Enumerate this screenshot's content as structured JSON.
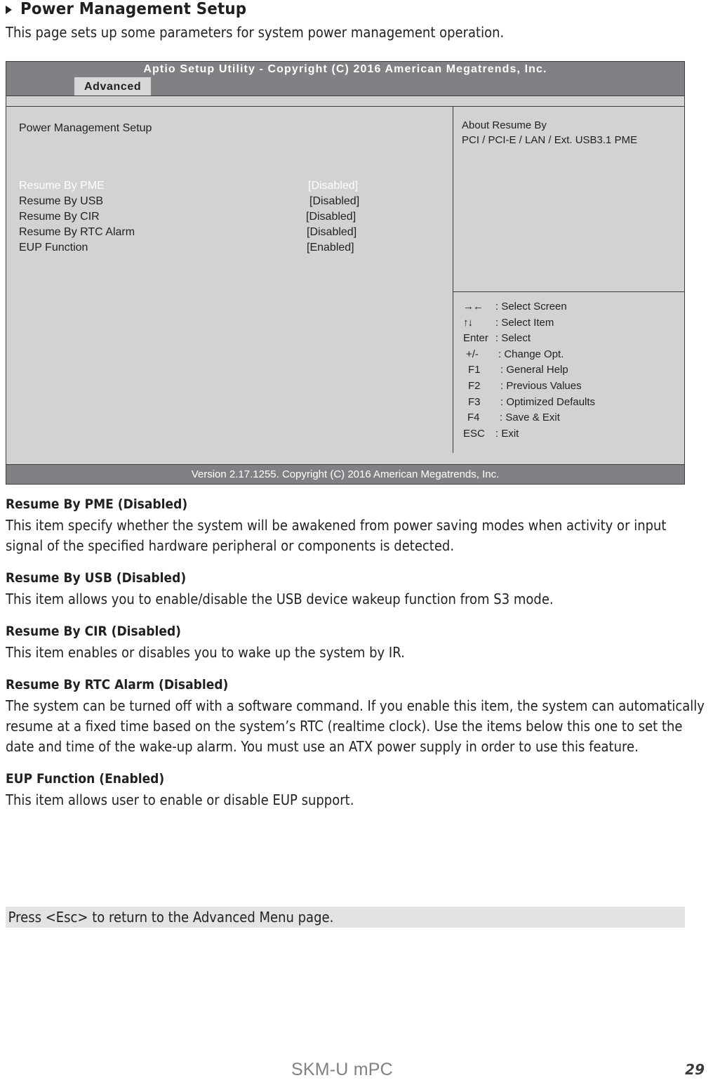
{
  "page": {
    "heading": "Power Management Setup",
    "intro": "This page sets up some parameters for system power management operation.",
    "bullet_icon": "triangle-right-icon",
    "brand": "SKM-U mPC",
    "number": "29",
    "esc_note": "Press <Esc> to return to the Advanced Menu page."
  },
  "bios": {
    "title": "Aptio Setup Utility - Copyright (C) 2016 American Megatrends, Inc.",
    "tab": "Advanced",
    "section_title": "Power Management Setup",
    "footer": "Version 2.17.1255. Copyright (C) 2016 American Megatrends, Inc.",
    "options": [
      {
        "label": "Resume By PME",
        "value": "[Disabled]",
        "selected": true
      },
      {
        "label": "Resume By USB",
        "value": "[Disabled]",
        "selected": false
      },
      {
        "label": "Resume By CIR",
        "value": "[Disabled]",
        "selected": false
      },
      {
        "label": "Resume By RTC Alarm",
        "value": "[Disabled]",
        "selected": false
      },
      {
        "label": "EUP Function",
        "value": "[Enabled]",
        "selected": false
      }
    ],
    "help": {
      "line1": "About Resume By",
      "line2": "PCI / PCI-E / LAN / Ext. USB3.1 PME"
    },
    "legend": [
      {
        "key": "→←",
        "desc": ": Select Screen"
      },
      {
        "key": "↑↓",
        "desc": ": Select Item"
      },
      {
        "key": "Enter",
        "desc": ": Select"
      },
      {
        "key": "+/-",
        "desc": ": Change Opt."
      },
      {
        "key": "F1",
        "desc": ": General Help"
      },
      {
        "key": "F2",
        "desc": ": Previous Values"
      },
      {
        "key": "F3",
        "desc": ": Optimized Defaults"
      },
      {
        "key": "F4",
        "desc": ": Save & Exit"
      },
      {
        "key": "ESC",
        "desc": ": Exit"
      }
    ],
    "colors": {
      "chrome": "#808184",
      "panel": "#d0d2d3",
      "tab": "#d6d7d8",
      "border": "#3c3c3c",
      "selected_text": "#ffffff"
    }
  },
  "descriptions": [
    {
      "heading": "Resume By PME (Disabled)",
      "body": "This item specify whether the system will be awakened from power saving modes when activity or input signal of the specified hardware peripheral or components is detected."
    },
    {
      "heading": "Resume By USB (Disabled)",
      "body": "This item allows you to enable/disable the USB device wakeup function from S3 mode."
    },
    {
      "heading": "Resume By CIR (Disabled)",
      "body": "This item enables or disables you to wake up the system by IR."
    },
    {
      "heading": "Resume By RTC Alarm (Disabled)",
      "body": "The system can be turned off with a software command. If you enable this item, the system can automatically resume at a fixed time based on the system’s RTC (realtime clock). Use the items below this one to set the date and time of the wake-up alarm. You must use an ATX power supply in order to use this feature."
    },
    {
      "heading": "EUP Function (Enabled)",
      "body": "This item allows user to enable or disable EUP support."
    }
  ]
}
